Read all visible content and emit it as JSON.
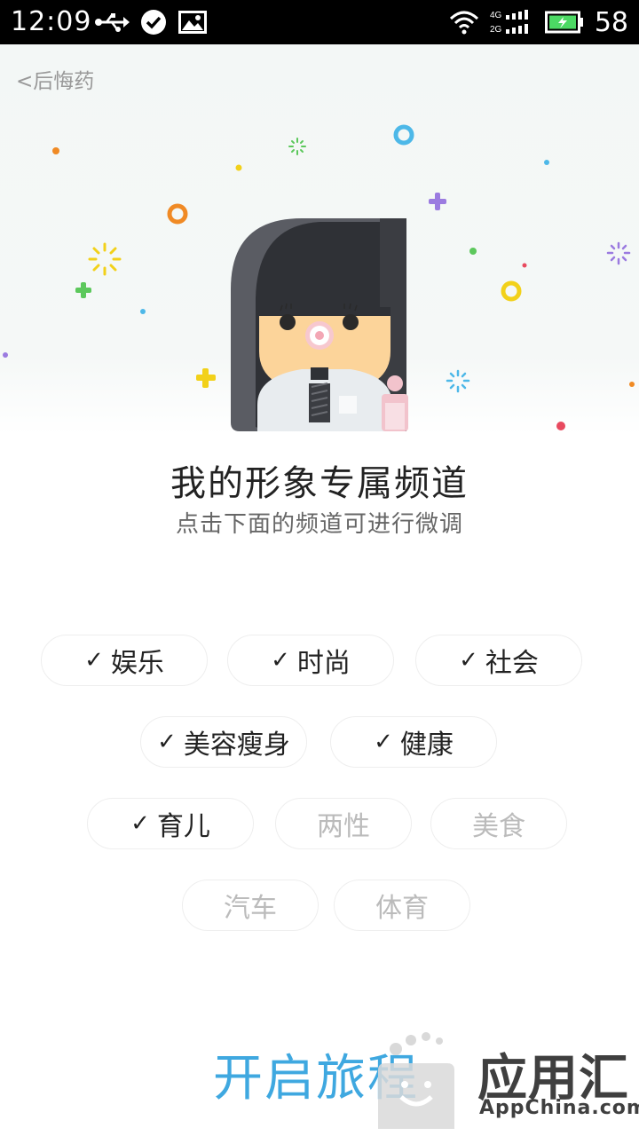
{
  "status_bar": {
    "time": "12:09",
    "battery": "58",
    "network_labels": [
      "4G",
      "2G"
    ]
  },
  "header": {
    "back_label": "<后悔药"
  },
  "profile": {
    "title": "我的形象专属频道",
    "subtitle": "点击下面的频道可进行微调"
  },
  "channels": [
    {
      "label": "娱乐",
      "selected": true
    },
    {
      "label": "时尚",
      "selected": true
    },
    {
      "label": "社会",
      "selected": true
    },
    {
      "label": "美容瘦身",
      "selected": true
    },
    {
      "label": "健康",
      "selected": true
    },
    {
      "label": "育儿",
      "selected": true
    },
    {
      "label": "两性",
      "selected": false
    },
    {
      "label": "美食",
      "selected": false
    },
    {
      "label": "汽车",
      "selected": false
    },
    {
      "label": "体育",
      "selected": false
    }
  ],
  "check_mark": "✓",
  "start_button": "开启旅程",
  "watermark": {
    "brand": "应用汇",
    "url": "AppChina.com"
  },
  "colors": {
    "accent": "#3fa8e0",
    "selected_text": "#222222",
    "unselected_text": "#bbbbbb"
  }
}
